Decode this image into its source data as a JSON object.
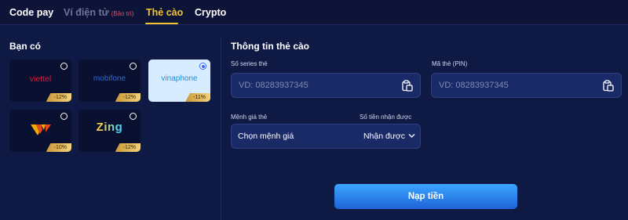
{
  "tabs": {
    "items": [
      {
        "label": "Code pay"
      },
      {
        "label": "Ví điện tử",
        "badge": "(Bảo trì)"
      },
      {
        "label": "Thẻ cào"
      },
      {
        "label": "Crypto"
      }
    ],
    "active_index": 2
  },
  "providers": {
    "title": "Bạn có",
    "cards": [
      {
        "logo": "viettel",
        "discount": "-12%",
        "selected": false
      },
      {
        "logo": "mobifone",
        "discount": "-12%",
        "selected": false
      },
      {
        "logo": "vinaphone",
        "discount": "-11%",
        "selected": true
      },
      {
        "logo": "vietnamobile-logo",
        "discount": "-10%",
        "selected": false
      },
      {
        "logo": "Zing",
        "discount": "-12%",
        "selected": false
      }
    ]
  },
  "form": {
    "title": "Thông tin thẻ cào",
    "serial_label": "Số series thẻ",
    "serial_placeholder": "VD: 08283937345",
    "pin_label": "Mã thẻ (PIN)",
    "pin_placeholder": "VD: 08283937345",
    "denomination_label": "Mệnh giá thẻ",
    "received_label": "Số tiền nhận được",
    "denomination_value": "Chọn mệnh giá",
    "received_value": "Nhận được",
    "submit_label": "Nạp tiền"
  },
  "colors": {
    "background": "#0b1236",
    "panel": "#0e1a44",
    "accent": "#f4c430",
    "button": "#2b86f0",
    "maintenance": "#e0506a"
  }
}
